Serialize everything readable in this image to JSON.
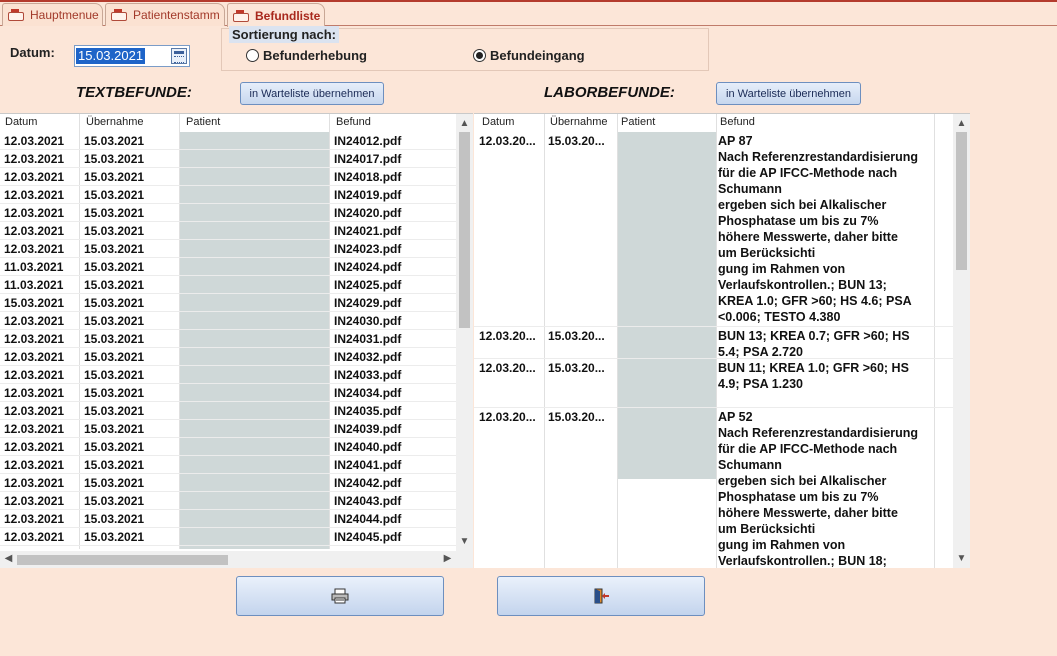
{
  "tabs": [
    {
      "label": "Hauptmenue",
      "active": false
    },
    {
      "label": "Patientenstamm",
      "active": false
    },
    {
      "label": "Befundliste",
      "active": true
    }
  ],
  "datum": {
    "label": "Datum:",
    "value": "15.03.2021"
  },
  "sortierung": {
    "label": "Sortierung nach:",
    "options": [
      {
        "label": "Befunderhebung",
        "selected": false
      },
      {
        "label": "Befundeingang",
        "selected": true
      }
    ]
  },
  "text": {
    "title": "TEXTBEFUNDE:",
    "button": "in Warteliste übernehmen",
    "columns": [
      "Datum",
      "Übernahme",
      "Patient",
      "Befund"
    ],
    "rows": [
      [
        "12.03.2021",
        "15.03.2021",
        "",
        "IN24012.pdf"
      ],
      [
        "12.03.2021",
        "15.03.2021",
        "",
        "IN24017.pdf"
      ],
      [
        "12.03.2021",
        "15.03.2021",
        "",
        "IN24018.pdf"
      ],
      [
        "12.03.2021",
        "15.03.2021",
        "",
        "IN24019.pdf"
      ],
      [
        "12.03.2021",
        "15.03.2021",
        "",
        "IN24020.pdf"
      ],
      [
        "12.03.2021",
        "15.03.2021",
        "",
        "IN24021.pdf"
      ],
      [
        "12.03.2021",
        "15.03.2021",
        "",
        "IN24023.pdf"
      ],
      [
        "11.03.2021",
        "15.03.2021",
        "",
        "IN24024.pdf"
      ],
      [
        "11.03.2021",
        "15.03.2021",
        "",
        "IN24025.pdf"
      ],
      [
        "15.03.2021",
        "15.03.2021",
        "",
        "IN24029.pdf"
      ],
      [
        "12.03.2021",
        "15.03.2021",
        "",
        "IN24030.pdf"
      ],
      [
        "12.03.2021",
        "15.03.2021",
        "",
        "IN24031.pdf"
      ],
      [
        "12.03.2021",
        "15.03.2021",
        "",
        "IN24032.pdf"
      ],
      [
        "12.03.2021",
        "15.03.2021",
        "",
        "IN24033.pdf"
      ],
      [
        "12.03.2021",
        "15.03.2021",
        "",
        "IN24034.pdf"
      ],
      [
        "12.03.2021",
        "15.03.2021",
        "",
        "IN24035.pdf"
      ],
      [
        "12.03.2021",
        "15.03.2021",
        "",
        "IN24039.pdf"
      ],
      [
        "12.03.2021",
        "15.03.2021",
        "",
        "IN24040.pdf"
      ],
      [
        "12.03.2021",
        "15.03.2021",
        "",
        "IN24041.pdf"
      ],
      [
        "12.03.2021",
        "15.03.2021",
        "",
        "IN24042.pdf"
      ],
      [
        "12.03.2021",
        "15.03.2021",
        "",
        "IN24043.pdf"
      ],
      [
        "12.03.2021",
        "15.03.2021",
        "",
        "IN24044.pdf"
      ],
      [
        "12.03.2021",
        "15.03.2021",
        "",
        "IN24045.pdf"
      ]
    ]
  },
  "labor": {
    "title": "LABORBEFUNDE:",
    "button": "in Warteliste übernehmen",
    "columns": [
      "Datum",
      "Übernahme",
      "Patient",
      "Befund"
    ],
    "rows": [
      [
        "12.03.20...",
        "15.03.20...",
        "",
        "AP 87\nNach Referenzrestandardisierung\nfür die AP IFCC-Methode nach\nSchumann\nergeben sich bei Alkalischer\nPhosphatase um bis zu 7%\nhöhere Messwerte, daher bitte\num Berücksichti\ngung im Rahmen von\nVerlaufskontrollen.; BUN 13;\nKREA 1.0; GFR >60; HS 4.6; PSA\n<0.006; TESTO 4.380"
      ],
      [
        "12.03.20...",
        "15.03.20...",
        "",
        "BUN 13; KREA 0.7; GFR >60; HS\n5.4; PSA 2.720"
      ],
      [
        "12.03.20...",
        "15.03.20...",
        "",
        "BUN 11; KREA 1.0; GFR >60; HS\n4.9; PSA 1.230"
      ],
      [
        "12.03.20...",
        "15.03.20...",
        "",
        "AP 52\nNach Referenzrestandardisierung\nfür die AP IFCC-Methode nach\nSchumann\nergeben sich bei Alkalischer\nPhosphatase um bis zu 7%\nhöhere Messwerte, daher bitte\num Berücksichti\ngung im Rahmen von\nVerlaufskontrollen.; BUN 18;"
      ]
    ]
  },
  "footer": {
    "print_icon": "printer-icon",
    "exit_icon": "exit-door-icon"
  }
}
